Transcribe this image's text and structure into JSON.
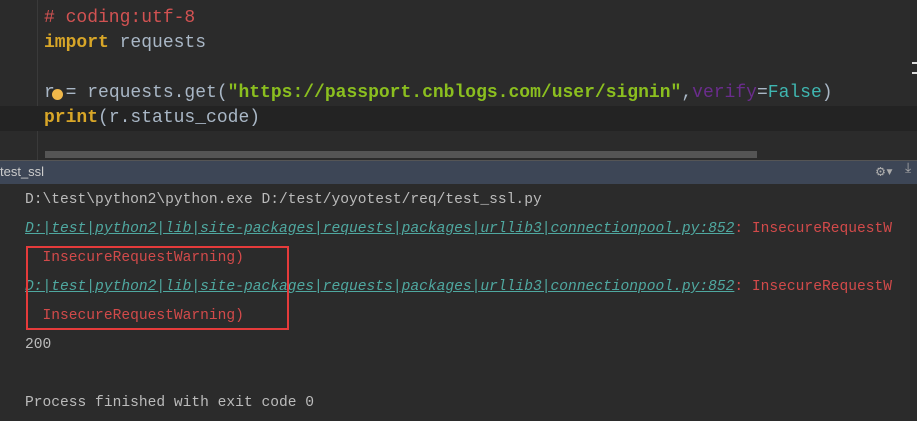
{
  "editor": {
    "line1": "# coding:utf-8",
    "line2_kw": "import",
    "line2_rest": " requests",
    "line4_var": "r",
    "line4_op": " = requests.get(",
    "line4_str": "\"https://passport.cnblogs.com/user/signin\"",
    "line4_comma": ",",
    "line4_kwarg": "verify",
    "line4_eq": "=",
    "line4_bool": "False",
    "line4_close": ")",
    "line5_kw": "print",
    "line5_rest": "(r.status_code)"
  },
  "toolwindow": {
    "title": "test_ssl",
    "gear_icon": "gear-icon",
    "pin_icon": "pin-icon"
  },
  "console": {
    "cmd": "D:\\test\\python2\\python.exe D:/test/yoyotest/req/test_ssl.py",
    "warn_path": "D:|test|python2|lib|site-packages|requests|packages|urllib3|connectionpool.py:852",
    "warn_sep": ": ",
    "warn_text": "InsecureRequestW",
    "warn_cont": "  InsecureRequestWarning)",
    "result": "200",
    "exit": "Process finished with exit code 0"
  }
}
